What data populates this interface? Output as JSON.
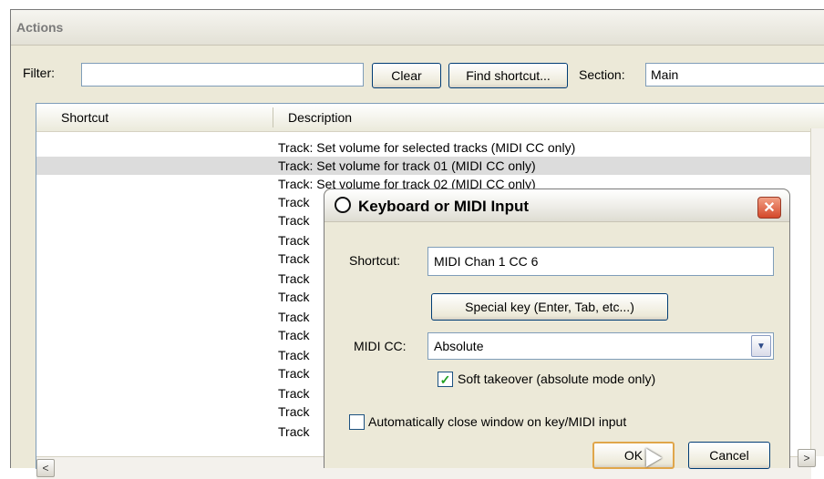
{
  "actions": {
    "title": "Actions",
    "filter_label": "Filter:",
    "filter_value": "",
    "clear_label": "Clear",
    "find_shortcut_label": "Find shortcut...",
    "section_label": "Section:",
    "section_value": "Main",
    "columns": [
      "Shortcut",
      "Description"
    ],
    "rows": [
      "Track: Set volume for selected tracks (MIDI CC only)",
      "Track: Set volume for track 01 (MIDI CC only)",
      "Track: Set volume for track 02 (MIDI CC only)",
      "Track",
      "Track",
      "Track",
      "Track",
      "Track",
      "Track",
      "Track",
      "Track",
      "Track",
      "Track",
      "Track",
      "Track",
      "Track"
    ],
    "scroll_left_glyph": "<",
    "scroll_right_glyph": ">"
  },
  "dialog": {
    "title": "Keyboard or MIDI Input",
    "close_glyph": "✕",
    "shortcut_label": "Shortcut:",
    "shortcut_value": "MIDI Chan 1 CC 6",
    "special_key_label": "Special key (Enter, Tab, etc...)",
    "midi_cc_label": "MIDI CC:",
    "midi_cc_value": "Absolute",
    "soft_takeover_label": "Soft takeover (absolute mode only)",
    "soft_takeover_checked": true,
    "auto_close_label": "Automatically close window on key/MIDI input",
    "auto_close_checked": false,
    "ok_label": "OK",
    "cancel_label": "Cancel"
  },
  "icons": {
    "dialog_icon": "reaper-logo-icon",
    "close": "close-icon",
    "dropdown": "chevron-down-icon",
    "checkmark": "checkmark-icon"
  }
}
